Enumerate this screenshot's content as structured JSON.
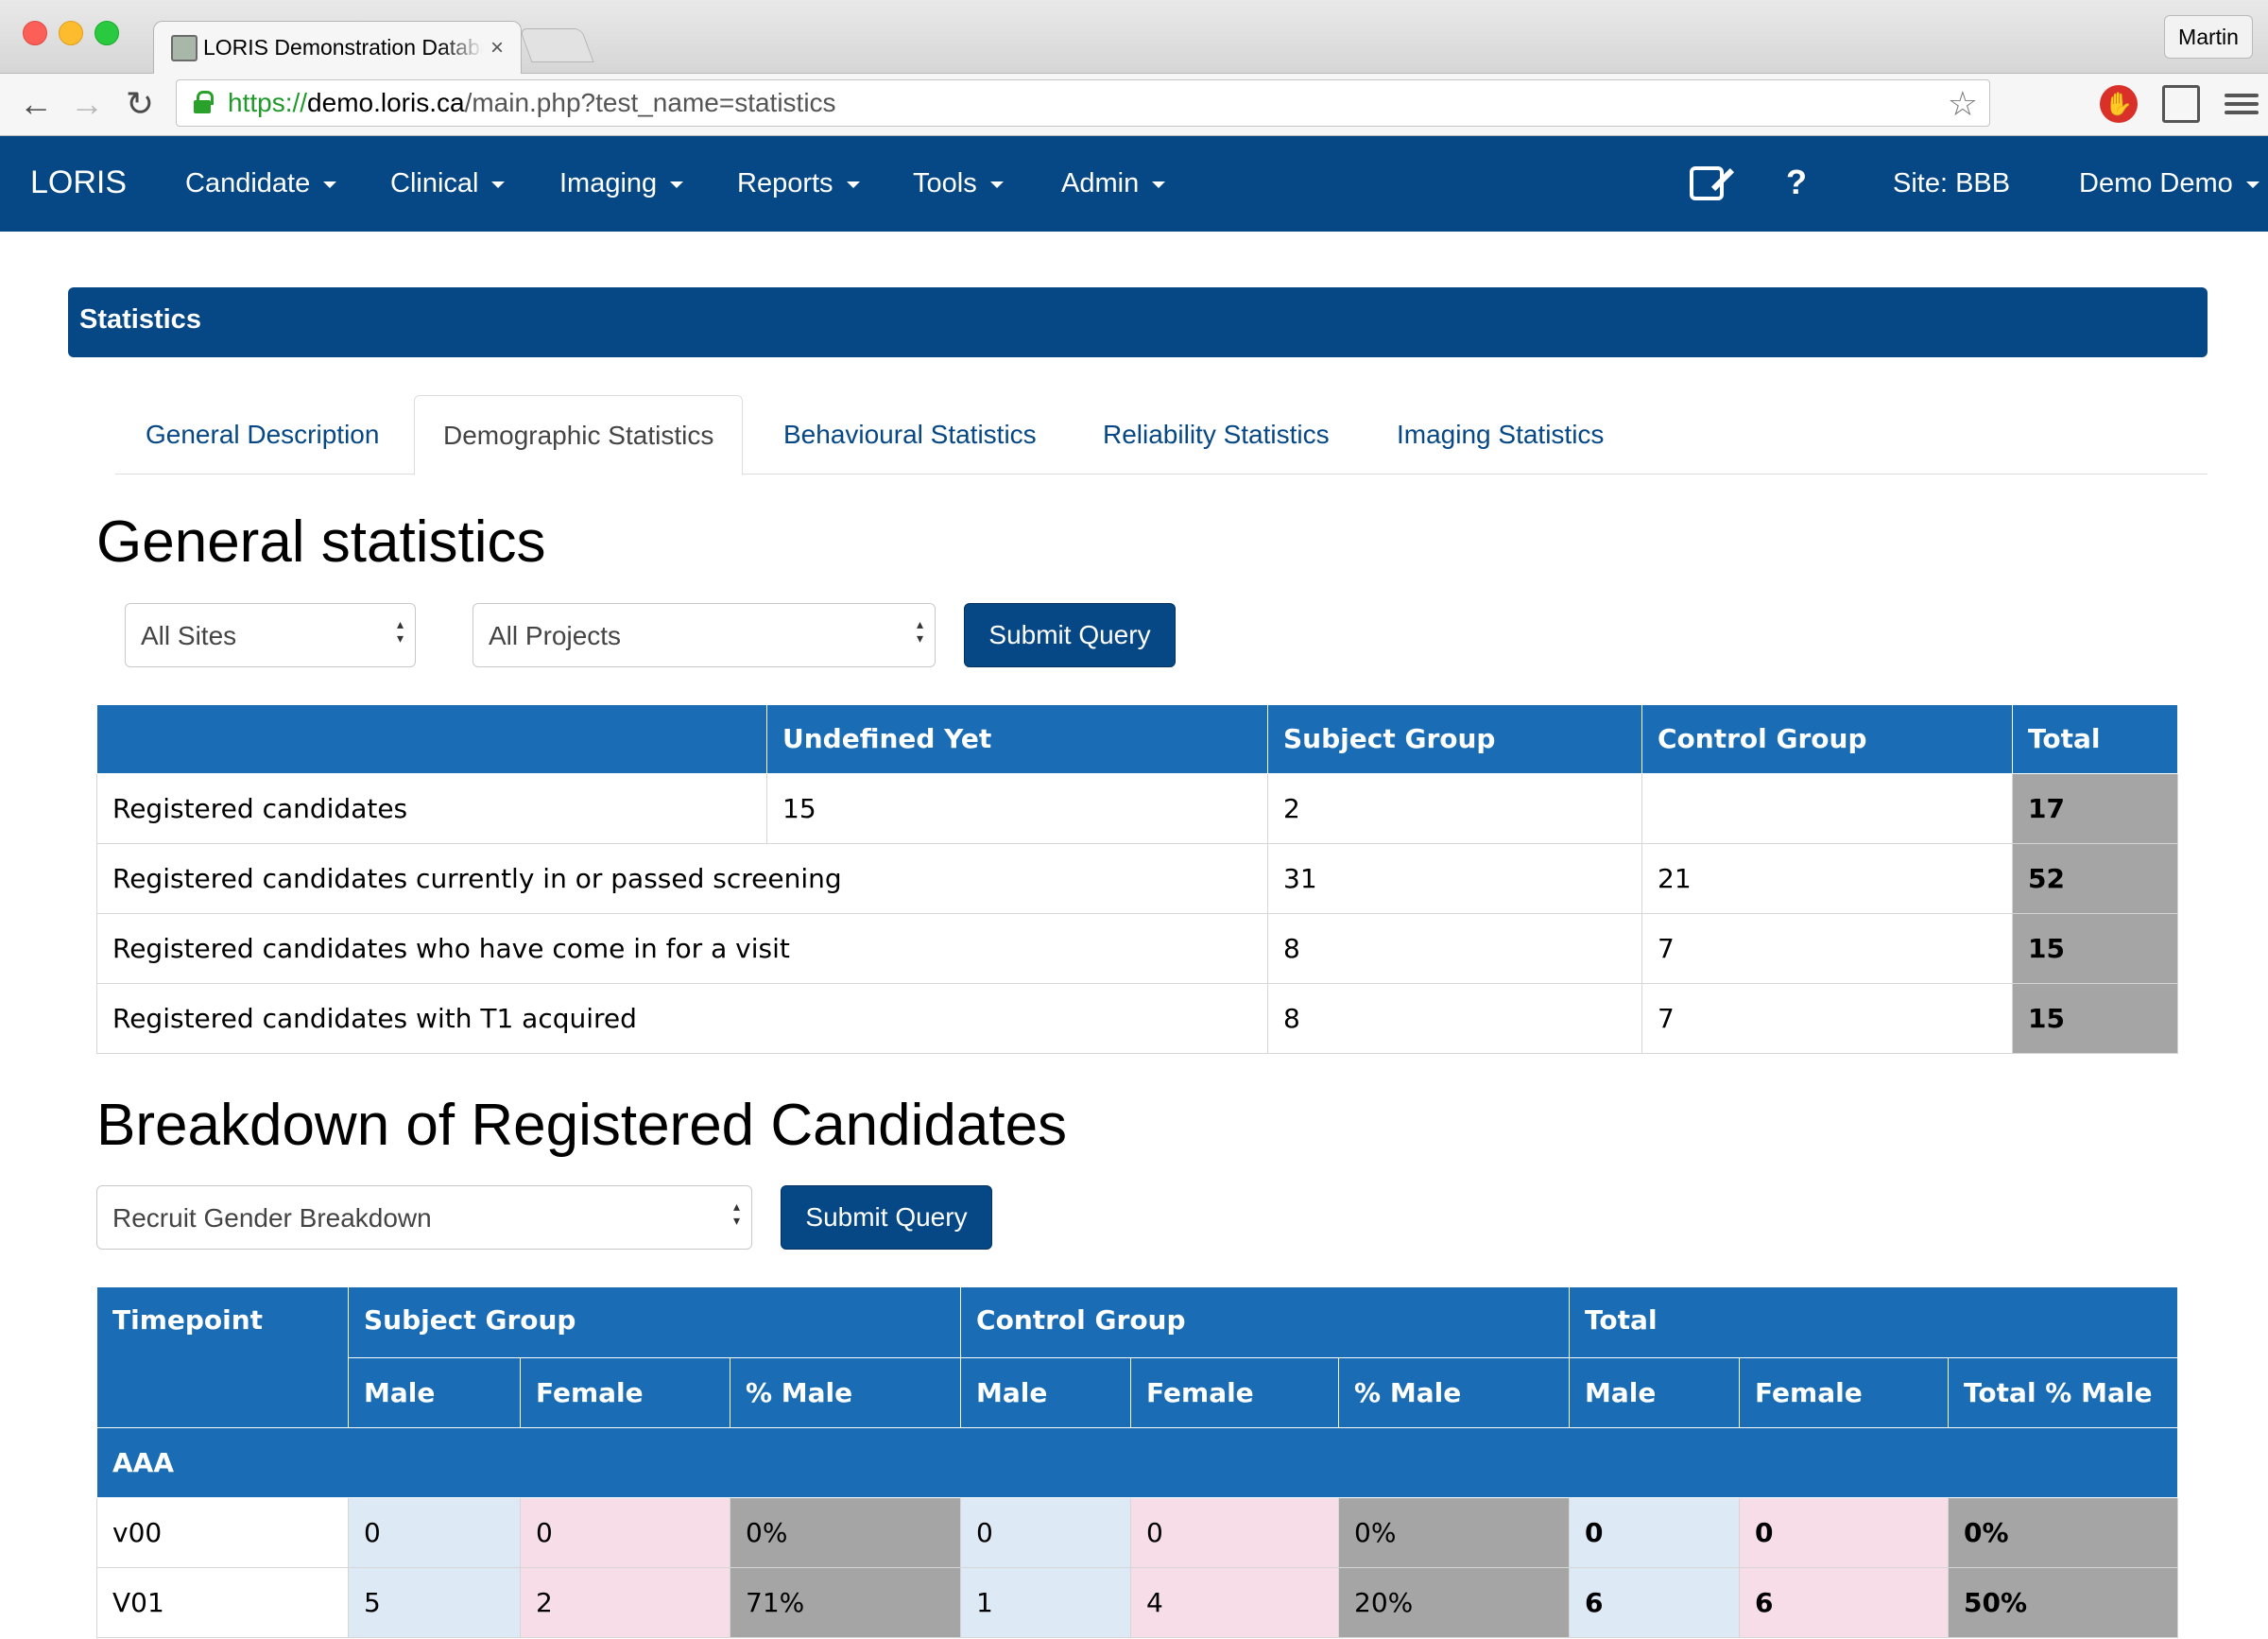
{
  "browser": {
    "tab_title": "LORIS Demonstration Database",
    "tab_close": "×",
    "profile": "Martin",
    "url_scheme": "https://",
    "url_host": "demo.loris.ca",
    "url_path": "/main.php?test_name=statistics",
    "icons": [
      "back-icon",
      "forward-icon",
      "reload-icon",
      "lock-icon",
      "star-icon",
      "stop-extension-icon",
      "cast-icon",
      "menu-icon"
    ]
  },
  "navbar": {
    "brand": "LORIS",
    "menus": [
      "Candidate",
      "Clinical",
      "Imaging",
      "Reports",
      "Tools",
      "Admin"
    ],
    "help": "?",
    "site": "Site: BBB",
    "user": "Demo Demo"
  },
  "panel": {
    "title": "Statistics"
  },
  "tabs": [
    "General Description",
    "Demographic Statistics",
    "Behavioural Statistics",
    "Reliability Statistics",
    "Imaging Statistics"
  ],
  "active_tab": "Demographic Statistics",
  "general": {
    "heading": "General statistics",
    "site_select": "All Sites",
    "project_select": "All Projects",
    "submit": "Submit Query",
    "columns": [
      "",
      "Undefined Yet",
      "Subject Group",
      "Control Group",
      "Total"
    ],
    "rows": [
      {
        "label": "Registered candidates",
        "undefined": "15",
        "subject": "2",
        "control": "",
        "total": "17"
      },
      {
        "label": "Registered candidates currently in or passed screening",
        "subject": "31",
        "control": "21",
        "total": "52"
      },
      {
        "label": "Registered candidates who have come in for a visit",
        "subject": "8",
        "control": "7",
        "total": "15"
      },
      {
        "label": "Registered candidates with T1 acquired",
        "subject": "8",
        "control": "7",
        "total": "15"
      }
    ]
  },
  "breakdown": {
    "heading": "Breakdown of Registered Candidates",
    "select": "Recruit Gender Breakdown",
    "submit": "Submit Query",
    "header": {
      "timepoint": "Timepoint",
      "subject": "Subject Group",
      "control": "Control Group",
      "total": "Total"
    },
    "subheader": {
      "male": "Male",
      "female": "Female",
      "pct_male": "% Male",
      "total_pct_male": "Total % Male"
    },
    "site": "AAA",
    "rows": [
      {
        "tp": "v00",
        "s_m": "0",
        "s_f": "0",
        "s_p": "0%",
        "c_m": "0",
        "c_f": "0",
        "c_p": "0%",
        "t_m": "0",
        "t_f": "0",
        "t_p": "0%"
      },
      {
        "tp": "V01",
        "s_m": "5",
        "s_f": "2",
        "s_p": "71%",
        "c_m": "1",
        "c_f": "4",
        "c_p": "20%",
        "t_m": "6",
        "t_f": "6",
        "t_p": "50%"
      }
    ]
  },
  "colors": {
    "brand": "#064785",
    "header": "#1a6db5",
    "male": "#dde9f5",
    "female": "#f7dde8",
    "total": "#a5a5a5"
  }
}
